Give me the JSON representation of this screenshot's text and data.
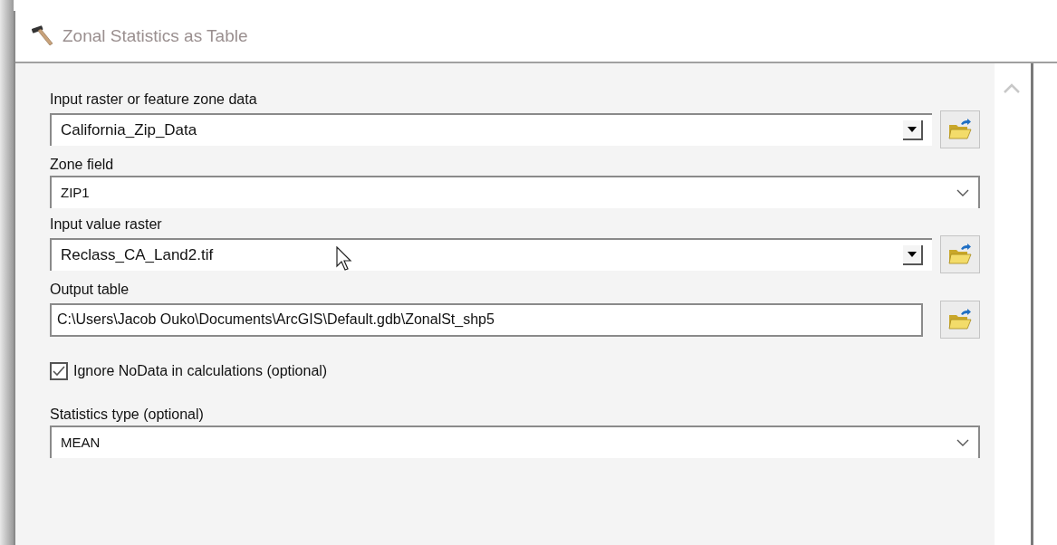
{
  "window": {
    "title": "Zonal Statistics as Table"
  },
  "parameters": [
    {
      "kind": "combo",
      "label": "Input raster or feature zone data",
      "value": "California_Zip_Data"
    },
    {
      "kind": "dropdown",
      "label": "Zone field",
      "value": "ZIP1"
    },
    {
      "kind": "combo",
      "label": "Input value raster",
      "value": "Reclass_CA_Land2.tif"
    },
    {
      "kind": "text",
      "label": "Output table",
      "value": "C:\\Users\\Jacob Ouko\\Documents\\ArcGIS\\Default.gdb\\ZonalSt_shp5"
    },
    {
      "kind": "checkbox",
      "label": "Ignore NoData in calculations (optional)",
      "checked": true
    },
    {
      "kind": "dropdown",
      "label": "Statistics type (optional)",
      "value": "MEAN"
    }
  ]
}
